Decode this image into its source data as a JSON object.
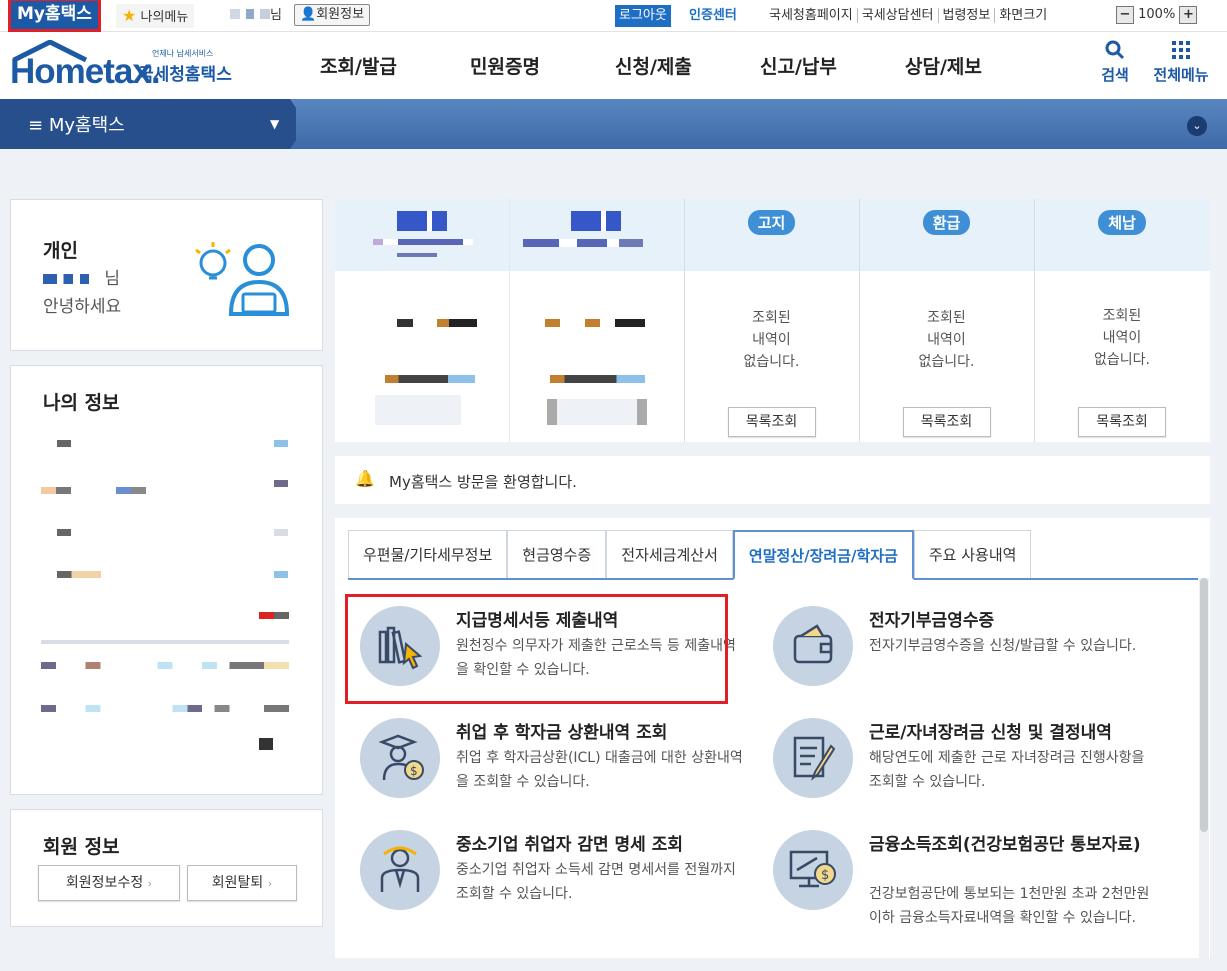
{
  "topbar": {
    "my_hometax": "My홈택스",
    "my_menu": "나의메뉴",
    "user_suffix": "님",
    "member_info": "회원정보",
    "logout": "로그아웃",
    "cert_center": "인증센터",
    "links": [
      "국세청홈페이지",
      "국세상담센터",
      "법령정보",
      "화면크기"
    ],
    "zoom": "100%"
  },
  "header": {
    "logo": "Hometax.",
    "logo_kr": "국세청홈택스",
    "logo_small": "언제나 납세서비스",
    "nav": [
      "조회/발급",
      "민원증명",
      "신청/제출",
      "신고/납부",
      "상담/제보"
    ],
    "search": "검색",
    "all_menu": "전체메뉴"
  },
  "bluebar": {
    "title": "My홈택스"
  },
  "profile": {
    "type": "개인",
    "suffix": "님",
    "greeting": "안녕하세요"
  },
  "myinfo": {
    "title": "나의 정보"
  },
  "member": {
    "title": "회원 정보",
    "edit": "회원정보수정",
    "withdraw": "회원탈퇴"
  },
  "summary": {
    "cols": [
      {
        "badge": "고지",
        "empty": "조회된\n내역이\n없습니다.",
        "button": "목록조회"
      },
      {
        "badge": "환급",
        "empty": "조회된\n내역이\n없습니다.",
        "button": "목록조회"
      },
      {
        "badge": "체납",
        "empty": "조회된\n내역이\n없습니다.",
        "button": "목록조회"
      }
    ]
  },
  "notice": {
    "text": "My홈택스 방문을 환영합니다."
  },
  "tabs": [
    "우편물/기타세무정보",
    "현금영수증",
    "전자세금계산서",
    "연말정산/장려금/학자금",
    "주요 사용내역"
  ],
  "services": [
    {
      "title": "지급명세서등 제출내역",
      "desc": "원천징수 의무자가 제출한 근로소득 등 제출내역을 확인할 수 있습니다."
    },
    {
      "title": "전자기부금영수증",
      "desc": "전자기부금영수증을 신청/발급할 수 있습니다."
    },
    {
      "title": "취업 후 학자금 상환내역 조회",
      "desc": "취업 후 학자금상환(ICL) 대출금에 대한 상환내역을 조회할 수 있습니다."
    },
    {
      "title": "근로/자녀장려금 신청 및 결정내역",
      "desc": "해당연도에 제출한 근로 자녀장려금 진행사항을 조회할 수 있습니다."
    },
    {
      "title": "중소기업 취업자 감면 명세 조회",
      "desc": "중소기업 취업자 소득세 감면 명세서를 전월까지 조회할 수 있습니다."
    },
    {
      "title": "금융소득조회(건강보험공단 통보자료)",
      "desc": "건강보험공단에 통보되는 1천만원 초과 2천만원 이하 금융소득자료내역을 확인할 수 있습니다."
    }
  ],
  "colors": {
    "brand": "#1d5aa5",
    "highlight": "#e21f26",
    "accent": "#1e6fc4"
  }
}
